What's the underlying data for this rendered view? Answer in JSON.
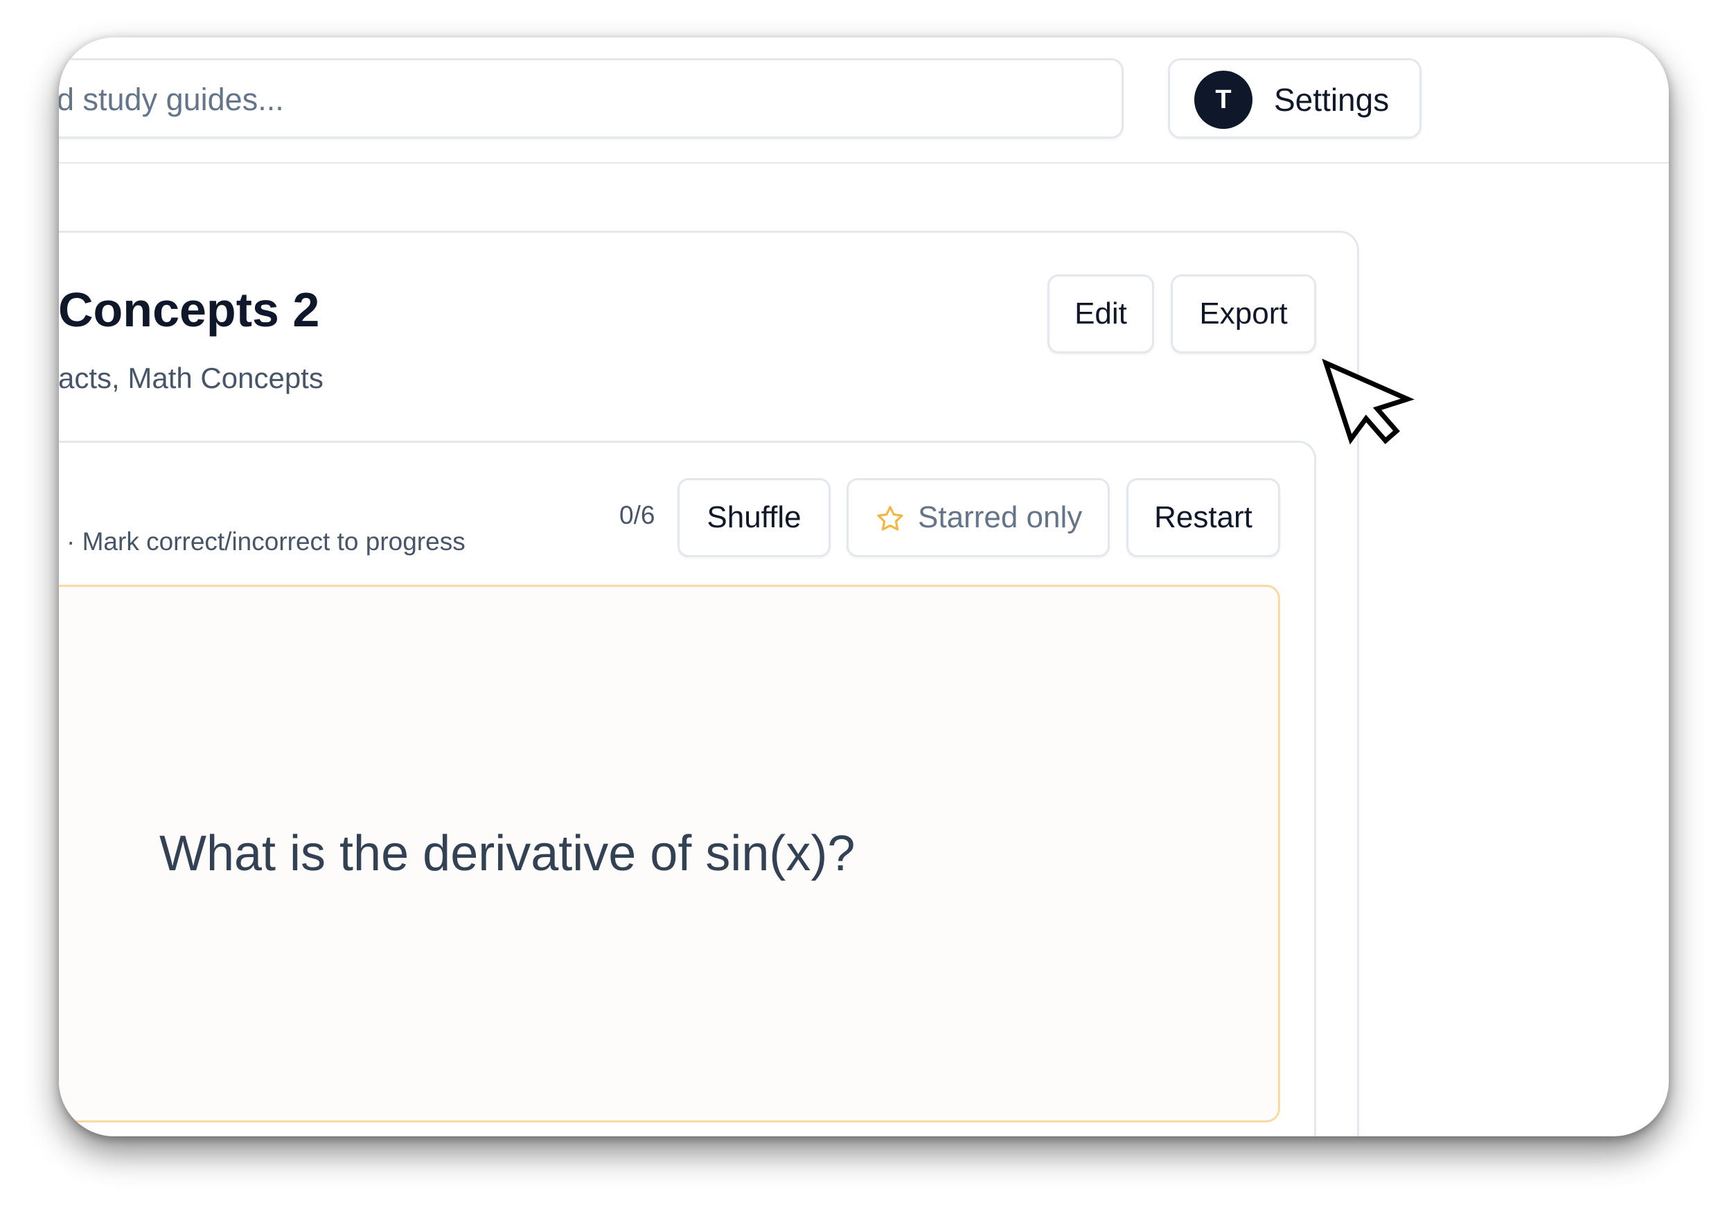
{
  "header": {
    "search_text": "d study guides...",
    "settings": {
      "avatar_initial": "T",
      "label": "Settings"
    }
  },
  "deck": {
    "title": "Concepts 2",
    "subtitle": "acts, Math Concepts",
    "actions": {
      "edit_label": "Edit",
      "export_label": "Export"
    }
  },
  "study": {
    "hint": "· Mark correct/incorrect to progress",
    "progress": "0/6",
    "shuffle_label": "Shuffle",
    "starred_label": "Starred only",
    "restart_label": "Restart"
  },
  "flashcard": {
    "question": "What is the derivative of sin(x)?"
  },
  "colors": {
    "accent_star": "#f5b53f",
    "card_border": "#fbd9a4",
    "avatar_bg": "#0f172a"
  },
  "icons": {
    "star": "star-icon",
    "cursor": "mouse-pointer-icon"
  }
}
